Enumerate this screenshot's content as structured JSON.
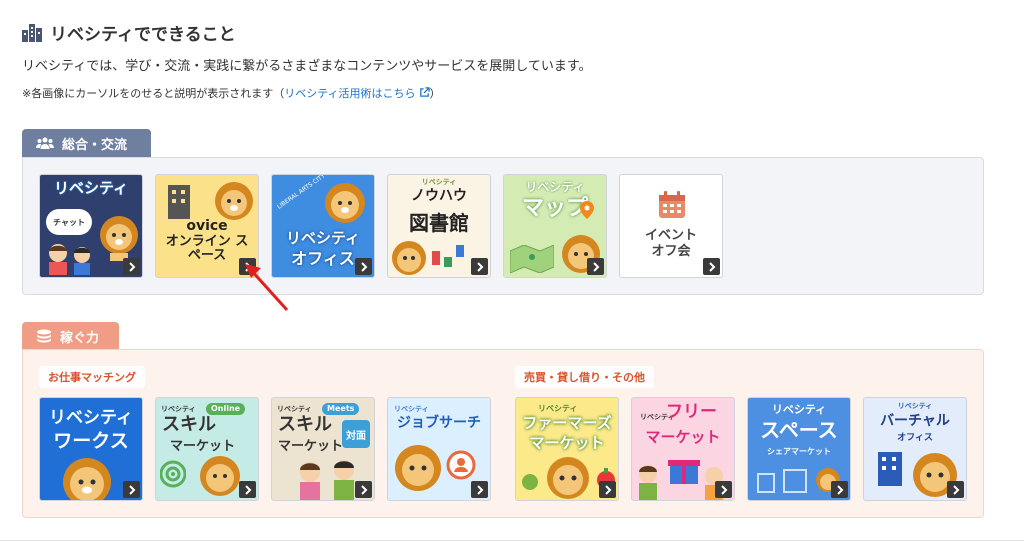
{
  "header": {
    "title": "リベシティでできること",
    "description": "リベシティでは、学び・交流・実践に繋がるさまざまなコンテンツやサービスを展開しています。",
    "note_prefix": "※各画像にカーソルをのせると説明が表示されます（",
    "note_link": "リベシティ活用術はこちら",
    "note_suffix": "）"
  },
  "sections": {
    "general": {
      "label": "総合・交流",
      "tiles": [
        {
          "title": "リベシティ",
          "sub": "チャット"
        },
        {
          "title": "ovice",
          "sub": "オンライン スペース"
        },
        {
          "title": "リベシティ",
          "sub": "オフィス",
          "top": "LIBERAL ARTS CITY"
        },
        {
          "title": "ノウハウ",
          "sub": "図書館",
          "top": "リベシティ"
        },
        {
          "title": "リベシティ",
          "sub": "マップ"
        },
        {
          "title": "イベント",
          "sub": "オフ会"
        }
      ]
    },
    "earn": {
      "label": "稼ぐ力",
      "group1": {
        "label": "お仕事マッチング",
        "tiles": [
          {
            "title": "リベシティ",
            "sub": "ワークス"
          },
          {
            "title": "スキル",
            "sub": "マーケット",
            "badge": "Online",
            "brand": "リベシティ"
          },
          {
            "title": "スキル",
            "sub": "マーケット",
            "badge": "Meets",
            "badge2": "対面",
            "brand": "リベシティ"
          },
          {
            "title": "ジョブサーチ",
            "brand": "リベシティ"
          }
        ]
      },
      "group2": {
        "label": "売買・貸し借り・その他",
        "tiles": [
          {
            "title": "ファーマーズ",
            "sub": "マーケット",
            "brand": "リベシティ"
          },
          {
            "title": "フリー",
            "sub": "マーケット",
            "brand": "リベシティ"
          },
          {
            "title": "スペース",
            "sub": "シェアマーケット",
            "brand": "リベシティ"
          },
          {
            "title": "バーチャル",
            "sub": "オフィス",
            "brand": "リベシティ"
          }
        ]
      }
    }
  },
  "colors": {
    "tab_general": "#6f7fa0",
    "tab_earn": "#ef9d84",
    "link": "#1a73c8",
    "pointer": "#e02020"
  }
}
